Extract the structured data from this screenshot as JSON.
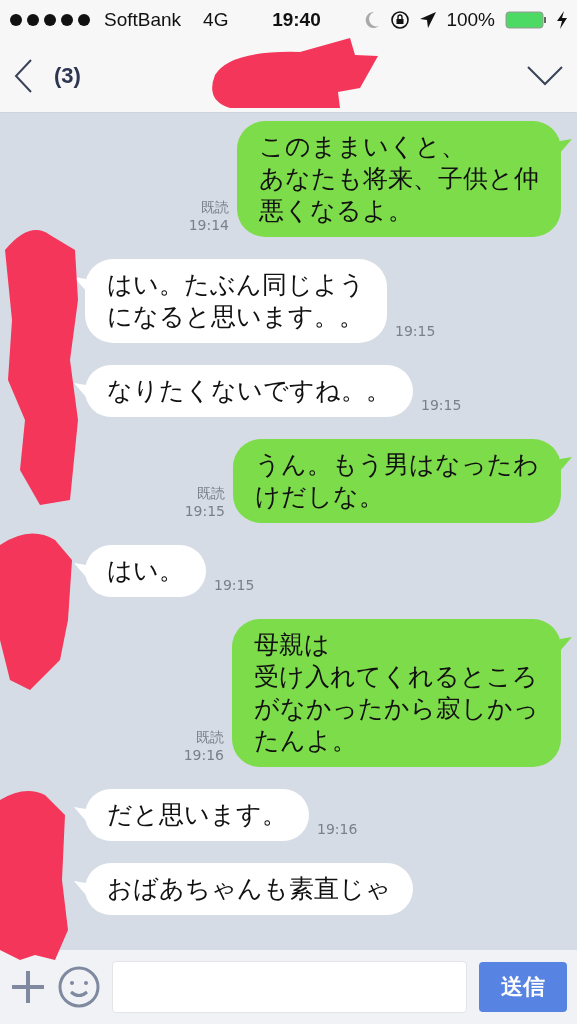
{
  "status_bar": {
    "carrier": "SoftBank",
    "network": "4G",
    "time": "19:40",
    "battery": "100%"
  },
  "header": {
    "unread_count": "(3)"
  },
  "messages": [
    {
      "kind": "sent",
      "lines": [
        "このままいくと、",
        "あなたも将来、子供と仲",
        "悪くなるよ。"
      ],
      "read": "既読",
      "time": "19:14"
    },
    {
      "kind": "received",
      "lines": [
        "はい。たぶん同じよう",
        "になると思います。。"
      ],
      "time": "19:15"
    },
    {
      "kind": "received",
      "lines": [
        "なりたくないですね。。"
      ],
      "time": "19:15"
    },
    {
      "kind": "sent",
      "lines": [
        "うん。もう男はなったわ",
        "けだしな。"
      ],
      "read": "既読",
      "time": "19:15"
    },
    {
      "kind": "received",
      "lines": [
        "はい。"
      ],
      "time": "19:15"
    },
    {
      "kind": "sent",
      "lines": [
        "母親は",
        "受け入れてくれるところ",
        "がなかったから寂しかっ",
        "たんよ。"
      ],
      "read": "既読",
      "time": "19:16"
    },
    {
      "kind": "received",
      "lines": [
        "だと思います。"
      ],
      "time": "19:16"
    },
    {
      "kind": "received",
      "lines": [
        "おばあちゃんも素直じゃ"
      ]
    }
  ],
  "composer": {
    "send_button": "送信"
  }
}
